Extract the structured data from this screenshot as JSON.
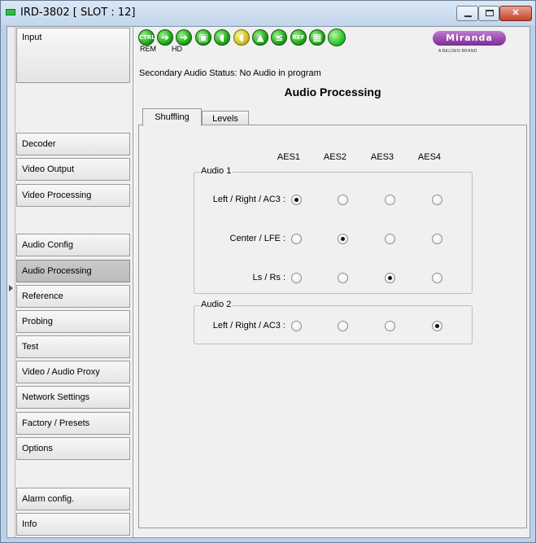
{
  "window": {
    "title": "IRD-3802 [ SLOT : 12]"
  },
  "nav": {
    "items": [
      {
        "label": "Input",
        "active": false
      },
      {
        "label": "Decoder",
        "active": false
      },
      {
        "label": "Video Output",
        "active": false
      },
      {
        "label": "Video Processing",
        "active": false
      },
      {
        "label": "Audio Config",
        "active": false
      },
      {
        "label": "Audio Processing",
        "active": true
      },
      {
        "label": "Reference",
        "active": false
      },
      {
        "label": "Probing",
        "active": false
      },
      {
        "label": "Test",
        "active": false
      },
      {
        "label": "Video / Audio Proxy",
        "active": false
      },
      {
        "label": "Network Settings",
        "active": false
      },
      {
        "label": "Factory / Presets",
        "active": false
      },
      {
        "label": "Options",
        "active": false
      },
      {
        "label": "Alarm config.",
        "active": false
      },
      {
        "label": "Info",
        "active": false
      }
    ]
  },
  "status_icons": {
    "ctrl": "CTRL",
    "ref": "REF",
    "rem_label": "REM",
    "hd_label": "HD",
    "icon_names": [
      "ctrl-icon",
      "arrow-right-icon",
      "arrow-right-icon",
      "video-icon",
      "audio-icon",
      "audio-icon",
      "lock-icon",
      "compare-icon",
      "ref-icon",
      "color-bars-icon",
      "status-led-icon"
    ]
  },
  "logo": {
    "text": "Miranda",
    "sub": "A BELDEN BRAND",
    "color": "#7d2a92"
  },
  "main": {
    "secondary_status": "Secondary Audio Status: No Audio in program",
    "title": "Audio Processing",
    "tabs": [
      {
        "label": "Shuffling",
        "selected": true
      },
      {
        "label": "Levels",
        "selected": false
      }
    ]
  },
  "shuffling": {
    "columns": [
      "AES1",
      "AES2",
      "AES3",
      "AES4"
    ],
    "groups": [
      {
        "title": "Audio 1",
        "rows": [
          {
            "label": "Left / Right / AC3 :",
            "selected": 0
          },
          {
            "label": "Center / LFE :",
            "selected": 1
          },
          {
            "label": "Ls / Rs :",
            "selected": 2
          }
        ]
      },
      {
        "title": "Audio 2",
        "rows": [
          {
            "label": "Left / Right / AC3 :",
            "selected": 3
          }
        ]
      }
    ]
  }
}
